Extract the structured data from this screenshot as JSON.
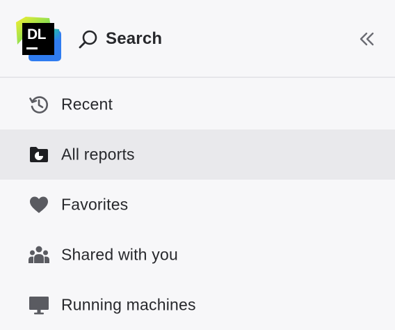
{
  "app": {
    "logo_text": "DL"
  },
  "header": {
    "search_label": "Search"
  },
  "nav": {
    "items": [
      {
        "label": "Recent",
        "icon": "history-icon",
        "active": false
      },
      {
        "label": "All reports",
        "icon": "folder-report-icon",
        "active": true
      },
      {
        "label": "Favorites",
        "icon": "heart-icon",
        "active": false
      },
      {
        "label": "Shared with you",
        "icon": "people-icon",
        "active": false
      },
      {
        "label": "Running machines",
        "icon": "monitor-icon",
        "active": false
      }
    ]
  },
  "colors": {
    "background": "#f7f7f9",
    "active_item_background": "#e9e9ec",
    "text": "#27282c",
    "icon": "#5a5b61"
  }
}
